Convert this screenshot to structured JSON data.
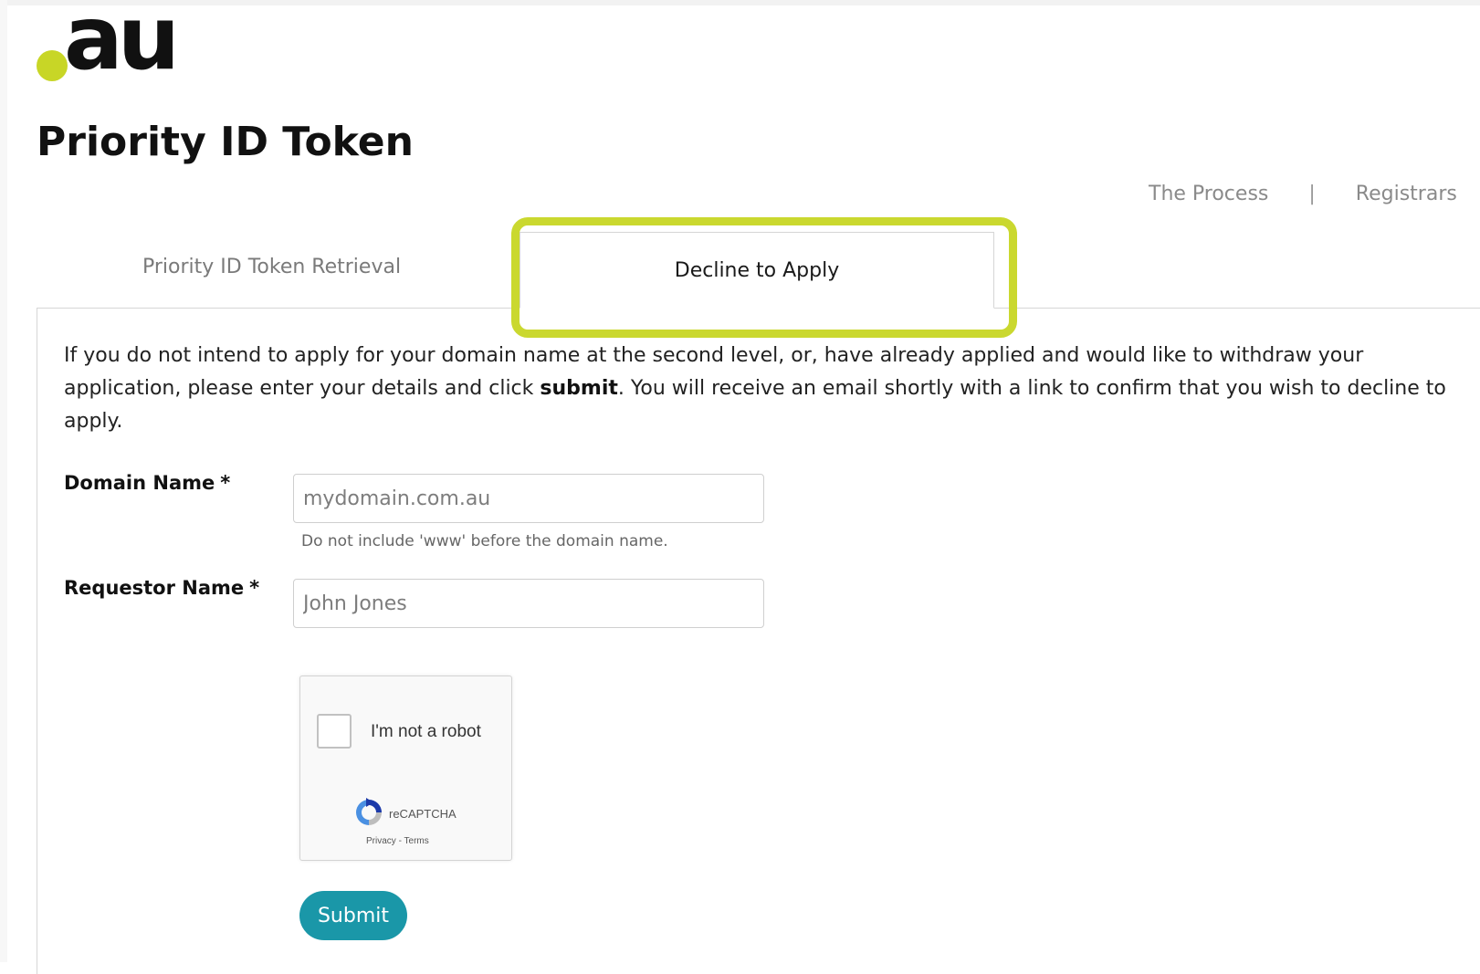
{
  "brand": {
    "logo_text": "au",
    "logo_dot_color": "#c8d626"
  },
  "page": {
    "title": "Priority ID Token"
  },
  "top_nav": {
    "items": [
      {
        "label": "The Process"
      },
      {
        "label": "Registrars"
      }
    ],
    "separator": "|"
  },
  "tabs": [
    {
      "label": "Priority ID Token Retrieval",
      "active": false
    },
    {
      "label": "Decline to Apply",
      "active": true
    }
  ],
  "intro": {
    "text_before": "If you do not intend to apply for your domain name at the second level, or, have already applied and would like to withdraw your application, please enter your details and click ",
    "bold": "submit",
    "text_after": ". You will receive an email shortly with a link to confirm that you wish to decline to apply."
  },
  "form": {
    "domain": {
      "label": "Domain Name",
      "required_mark": "*",
      "placeholder": "mydomain.com.au",
      "value": "",
      "help": "Do not include 'www' before the domain name."
    },
    "requestor": {
      "label": "Requestor Name",
      "required_mark": "*",
      "placeholder": "John Jones",
      "value": ""
    },
    "submit_label": "Submit",
    "submit_color": "#1a97a8"
  },
  "recaptcha": {
    "label": "I'm not a robot",
    "brand": "reCAPTCHA",
    "privacy": "Privacy",
    "separator": " - ",
    "terms": "Terms"
  },
  "highlight": {
    "color": "#cad82f",
    "target": "Decline to Apply"
  }
}
